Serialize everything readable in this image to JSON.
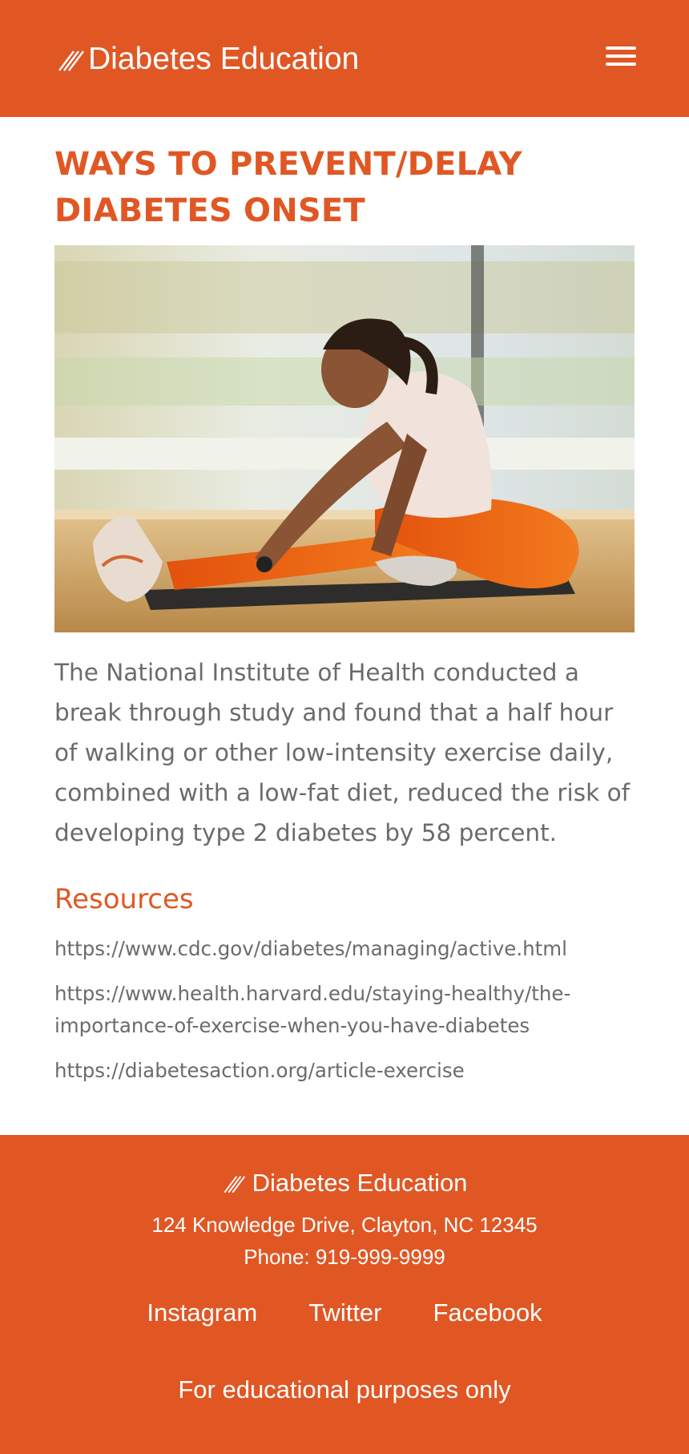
{
  "header": {
    "brand_name": "Diabetes Education",
    "logo_icon": "triple-slash-logo-icon",
    "menu_icon": "hamburger-menu-icon",
    "color": "#e05724"
  },
  "main": {
    "title": "WAYS TO PREVENT/DELAY DIABETES ONSET",
    "hero_image": "woman-stretching-on-yoga-mat-image",
    "body_text": "The National Institute of Health conducted a break through study and found that a half hour of walking or other low-intensity exercise daily, combined with a low-fat diet, reduced the risk of developing type 2 diabetes by 58 percent.",
    "resources_heading": "Resources",
    "resources": [
      "https://www.cdc.gov/diabetes/managing/active.html",
      "https://www.health.harvard.edu/staying-healthy/the-importance-of-exercise-when-you-have-diabetes",
      "https://diabetesaction.org/article-exercise"
    ]
  },
  "footer": {
    "brand_name": "Diabetes Education",
    "address": "124 Knowledge Drive, Clayton, NC 12345",
    "phone": "Phone: 919-999-9999",
    "social": [
      "Instagram",
      "Twitter",
      "Facebook"
    ],
    "note": "For educational purposes only"
  }
}
